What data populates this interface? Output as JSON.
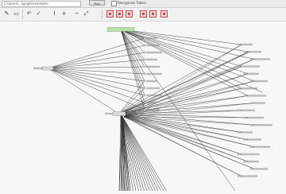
{
  "window": {
    "path_text": "C:\\Users\\...\\graph\\examples",
    "run_label": "Run",
    "option_label": "Reorganize Tables"
  },
  "toolbar": {
    "icons": [
      "pen-icon",
      "save-icon",
      "undo-icon",
      "check-icon",
      "text-cursor-icon",
      "zoom-in-icon",
      "zoom-out-icon",
      "fit-icon",
      "node-tool-icon",
      "edge-tool-icon",
      "group-tool-icon",
      "layout-tool-icon",
      "export-tool-icon",
      "delete-tool-icon"
    ]
  },
  "colors": {
    "accent_node": "#b9e4a8",
    "edge": "#333333",
    "canvas": "#f7f7f7",
    "toolbar_red": "#c04848"
  },
  "graph": {
    "hub_top_label": "",
    "hub_left_label": "",
    "hub_center_label": ""
  }
}
